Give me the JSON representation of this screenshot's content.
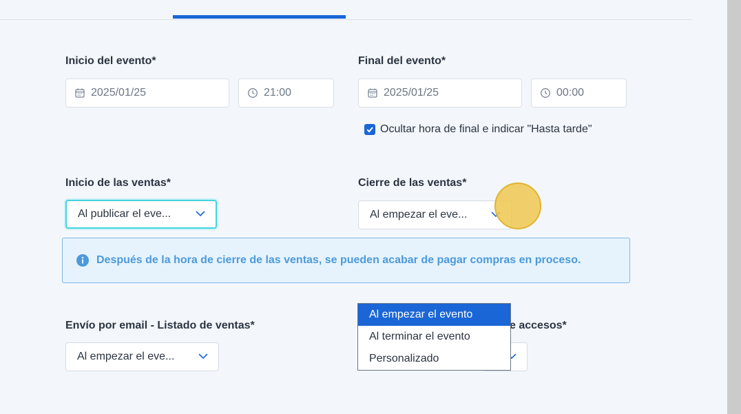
{
  "event_start": {
    "label": "Inicio del evento*",
    "date": "2025/01/25",
    "time": "21:00"
  },
  "event_end": {
    "label": "Final del evento*",
    "date": "2025/01/25",
    "time": "00:00",
    "hide_end_checkbox_label": "Ocultar hora de final e indicar \"Hasta tarde\"",
    "hide_end_checked": true
  },
  "sales_start": {
    "label": "Inicio de las ventas*",
    "selected": "Al publicar el eve..."
  },
  "sales_close": {
    "label": "Cierre de las ventas*",
    "selected": "Al empezar el eve..."
  },
  "info": {
    "text": "Después de la hora de cierre de las ventas, se pueden acabar de pagar compras en proceso."
  },
  "email_sales": {
    "label": "Envío por email - Listado de ventas*",
    "selected": "Al empezar el eve..."
  },
  "email_access": {
    "label_visible_fragment": "e accesos*"
  },
  "dropdown": {
    "options": [
      {
        "label": "Al empezar el evento",
        "selected": true
      },
      {
        "label": "Al terminar el evento",
        "selected": false
      },
      {
        "label": "Personalizado",
        "selected": false
      }
    ]
  },
  "colors": {
    "accent": "#1a66d6",
    "focus": "#47d3df",
    "info_text": "#4b9adb",
    "highlight": "#eec850"
  },
  "icons": {
    "date": "calendar-icon",
    "time": "clock-icon",
    "chevron": "chevron-down-icon",
    "info": "info-icon",
    "check": "check-icon"
  }
}
